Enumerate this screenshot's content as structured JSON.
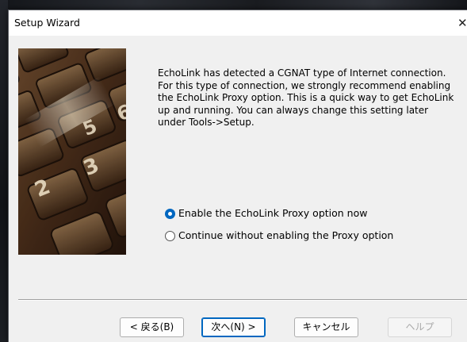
{
  "window": {
    "title": "Setup Wizard",
    "close_glyph": "✕"
  },
  "message": "EchoLink has detected a CGNAT type of Internet connection. For this type of connection, we strongly recommend enabling the EchoLink Proxy option. This is a quick way to get EchoLink up and running. You can always change this setting later under Tools->Setup.",
  "options": [
    {
      "label": "Enable the EchoLink Proxy option now",
      "selected": true
    },
    {
      "label": "Continue without enabling the Proxy option",
      "selected": false
    }
  ],
  "buttons": {
    "back": "< 戻る(B)",
    "next": "次へ(N) >",
    "cancel": "キャンセル",
    "help": "ヘルプ"
  },
  "side_image": {
    "icon": "calculator-keypad-photo",
    "keys": [
      "5",
      "6",
      "2",
      "3"
    ]
  },
  "colors": {
    "accent": "#0067c0",
    "dialog_bg": "#f0f0f0",
    "disabled_text": "#a8a8a8"
  }
}
